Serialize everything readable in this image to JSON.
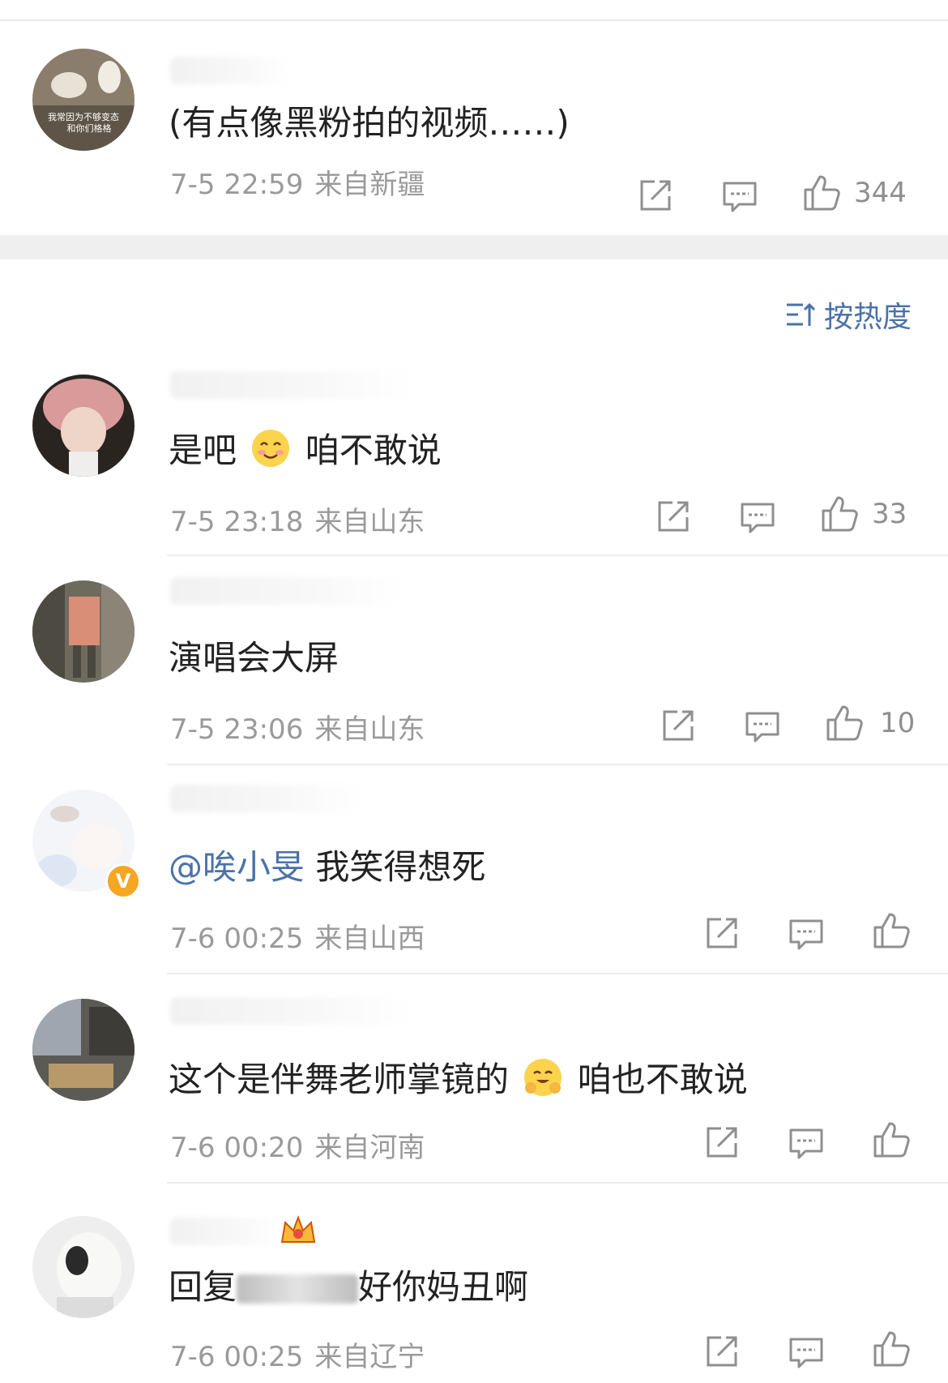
{
  "sort": {
    "label": "按热度",
    "icon": "sort-icon"
  },
  "avatar_captions": [
    "我常因为不够变态",
    "和你们格格"
  ],
  "comments": [
    {
      "text": "(有点像黑粉拍的视频……)",
      "time": "7-5 22:59",
      "source": "来自新疆",
      "likes": "344"
    },
    {
      "text_before": "是吧",
      "emoji": "smiling-face-emoji",
      "text_after": "咱不敢说",
      "time": "7-5 23:18",
      "source": "来自山东",
      "likes": "33"
    },
    {
      "text": "演唱会大屏",
      "time": "7-5 23:06",
      "source": "来自山东",
      "likes": "10"
    },
    {
      "mention": "@唉小旻",
      "text": "我笑得想死",
      "time": "7-6 00:25",
      "source": "来自山西",
      "likes": "",
      "verified_badge": "V"
    },
    {
      "text_before": "这个是伴舞老师掌镜的",
      "emoji": "hugging-face-emoji",
      "text_after": "咱也不敢说",
      "time": "7-6 00:20",
      "source": "来自河南",
      "likes": ""
    },
    {
      "text_before": "回复",
      "text_after": "好你妈丑啊",
      "time": "7-6 00:25",
      "source": "来自辽宁",
      "likes": ""
    }
  ],
  "colors": {
    "link": "#4a72a8",
    "meta": "#9a9a9a",
    "verified": "#f5a623"
  }
}
